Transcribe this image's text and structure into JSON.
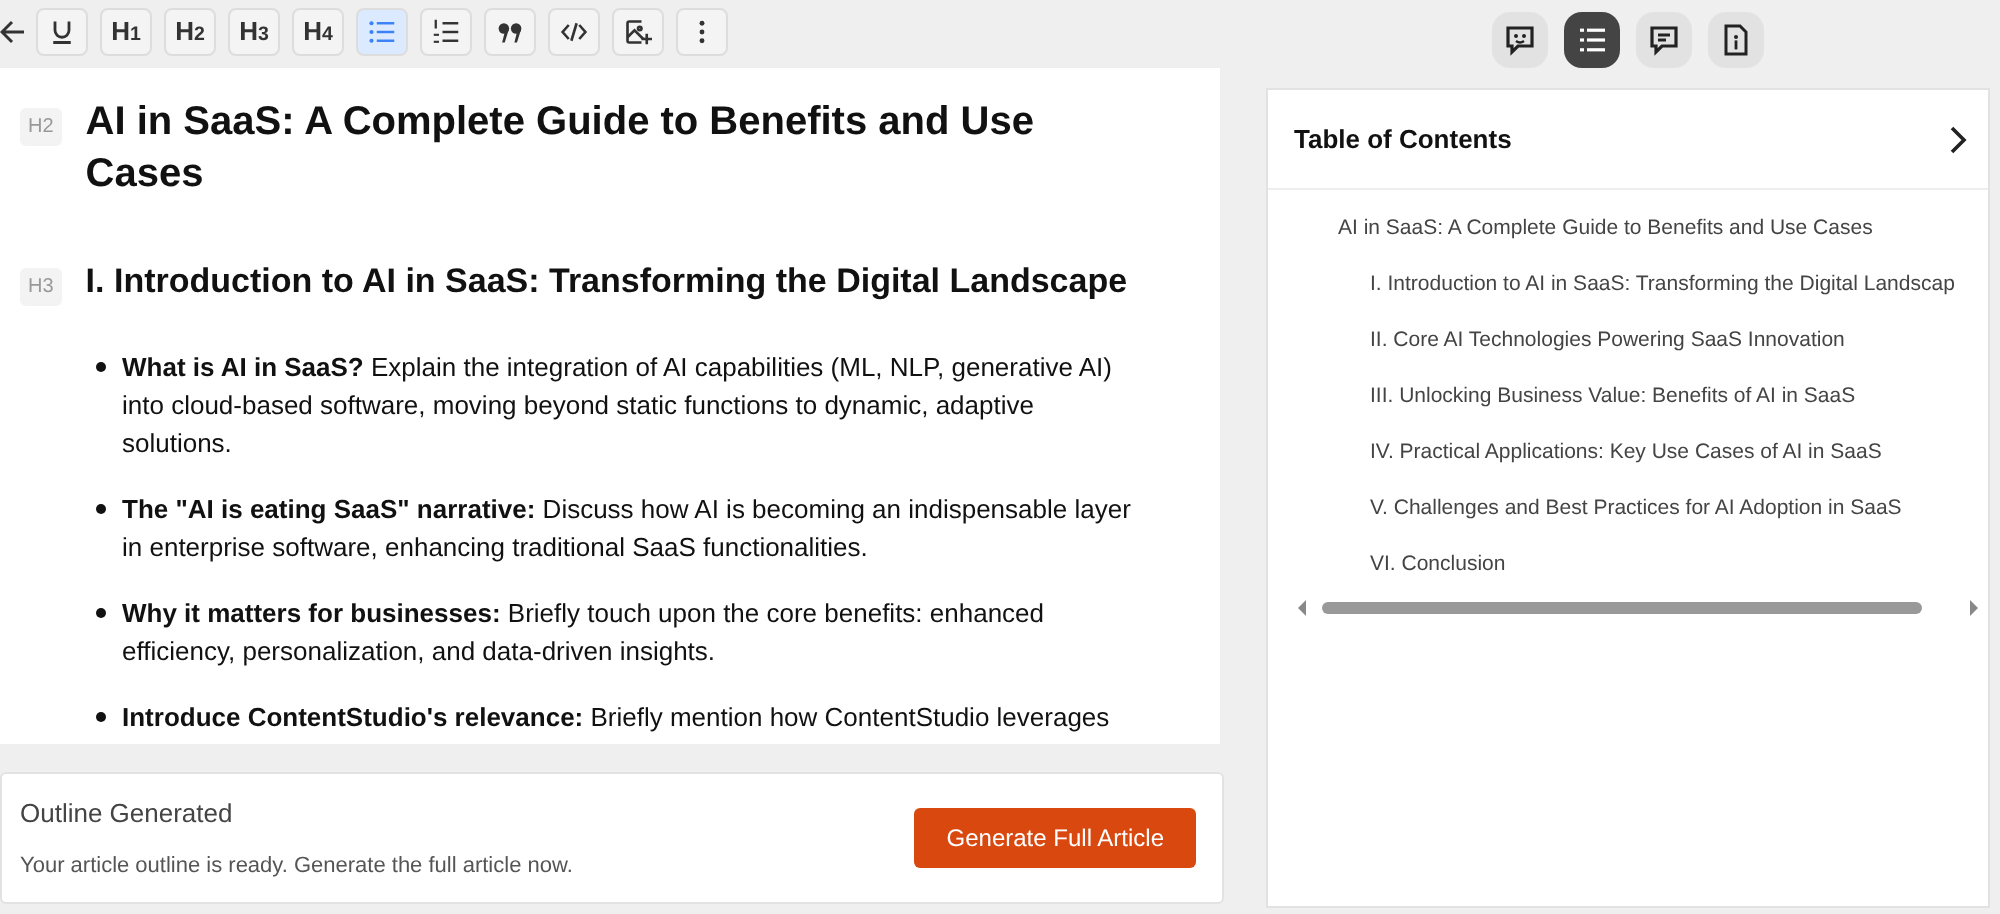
{
  "toolbar": [
    {
      "kind": "back",
      "selected": false
    },
    {
      "kind": "underline",
      "selected": false
    },
    {
      "kind": "heading",
      "label": "H$_{1}$",
      "selected": false
    },
    {
      "kind": "heading",
      "label": "H$_{2}$",
      "selected": false
    },
    {
      "kind": "heading",
      "label": "H$_{3}$",
      "selected": false
    },
    {
      "kind": "heading",
      "label": "H$_{4}$",
      "selected": false
    },
    {
      "kind": "bullets",
      "selected": true
    },
    {
      "kind": "numbers",
      "selected": false
    },
    {
      "kind": "quote",
      "selected": false
    },
    {
      "kind": "code",
      "selected": false
    },
    {
      "kind": "image",
      "selected": false
    },
    {
      "kind": "more",
      "selected": false
    }
  ],
  "panel_tabs": [
    {
      "kind": "chat",
      "selected": false
    },
    {
      "kind": "outline",
      "selected": true
    },
    {
      "kind": "comments",
      "selected": false
    },
    {
      "kind": "info",
      "selected": false
    }
  ],
  "editor": {
    "blocks": [
      {
        "kind": "heading",
        "tag": "H2",
        "text": "AI in SaaS: A Complete Guide to Benefits and Use Cases"
      },
      {
        "kind": "heading",
        "tag": "H3",
        "text": "I. Introduction to AI in SaaS: Transforming the Digital Landscape"
      },
      {
        "kind": "bullet",
        "text": "**What is AI in SaaS?** Explain the integration of AI capabilities (ML, NLP, generative AI) into cloud-based software, moving beyond static functions to dynamic, adaptive solutions."
      },
      {
        "kind": "bullet",
        "text": "**The \"AI is eating SaaS\" narrative:** Discuss how AI is becoming an indispensable layer in enterprise software, enhancing traditional SaaS functionalities."
      },
      {
        "kind": "bullet",
        "text": "**Why it matters for businesses:** Briefly touch upon the core benefits: enhanced efficiency, personalization, and data-driven insights."
      },
      {
        "kind": "bullet",
        "text": "**Introduce ContentStudio's relevance:** Briefly mention how ContentStudio leverages"
      }
    ]
  },
  "footer": {
    "title": "Outline Generated",
    "message": "Your article outline is ready. Generate the full article now.",
    "button": "Generate Full Article"
  },
  "toc": {
    "title": "Table of Contents",
    "items": [
      {
        "text": "AI in SaaS: A Complete Guide to Benefits and Use Cases",
        "children": [
          {
            "text": "I. Introduction to AI in SaaS: Transforming the Digital Landscap"
          },
          {
            "text": "II. Core AI Technologies Powering SaaS Innovation"
          },
          {
            "text": "III. Unlocking Business Value: Benefits of AI in SaaS"
          },
          {
            "text": "IV. Practical Applications: Key Use Cases of AI in SaaS"
          },
          {
            "text": "V. Challenges and Best Practices for AI Adoption in SaaS"
          },
          {
            "text": "VI. Conclusion"
          }
        ]
      }
    ]
  }
}
